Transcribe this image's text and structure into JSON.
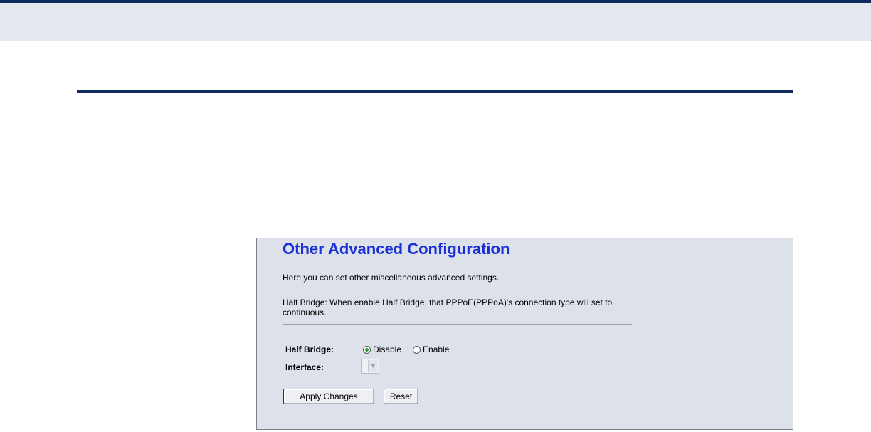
{
  "panel": {
    "title": "Other Advanced Configuration",
    "intro": "Here you can set other miscellaneous advanced settings.",
    "half_bridge_note": "Half Bridge: When enable Half Bridge, that PPPoE(PPPoA)'s connection type will set to continuous."
  },
  "form": {
    "half_bridge": {
      "label": "Half Bridge:",
      "options": [
        {
          "label": "Disable",
          "selected": true
        },
        {
          "label": "Enable",
          "selected": false
        }
      ]
    },
    "interface": {
      "label": "Interface:",
      "selected": "",
      "arrow_icon": "chevron-down-icon"
    }
  },
  "buttons": {
    "apply_label": "Apply Changes",
    "reset_label": "Reset"
  },
  "colors": {
    "title": "#1a2fd6",
    "panel_bg": "#dde2ea",
    "top_band": "#e5e8ef",
    "rule": "#0f2a5c",
    "radio_selected": "#2f9c2f"
  }
}
